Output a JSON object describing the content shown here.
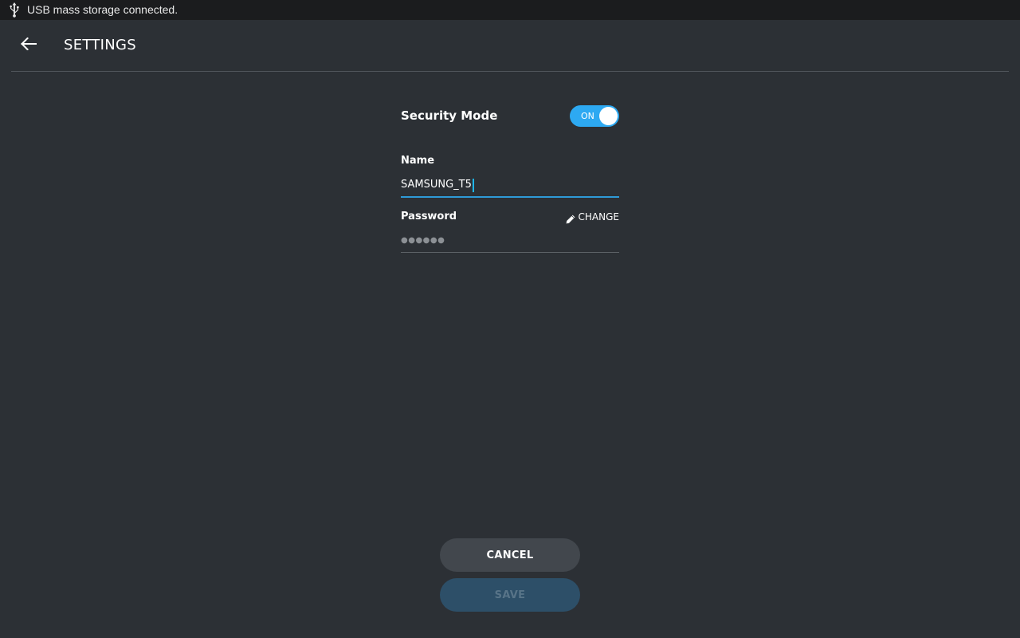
{
  "status_bar": {
    "icon": "usb-icon",
    "message": "USB mass storage connected."
  },
  "app_bar": {
    "back_icon": "arrow-left-icon",
    "title": "SETTINGS"
  },
  "security_mode": {
    "label": "Security Mode",
    "toggle_state": "ON",
    "toggle_color": "#2da9f2"
  },
  "name_field": {
    "label": "Name",
    "value": "SAMSUNG_T5"
  },
  "password_field": {
    "label": "Password",
    "masked_value": "●●●●●●",
    "change_label": "CHANGE",
    "change_icon": "pencil-icon"
  },
  "buttons": {
    "cancel_label": "CANCEL",
    "save_label": "SAVE"
  },
  "colors": {
    "background": "#2c3035",
    "status_bar": "#1b1c1e",
    "accent": "#2e9ad7",
    "save_disabled": "#2d4f68"
  }
}
